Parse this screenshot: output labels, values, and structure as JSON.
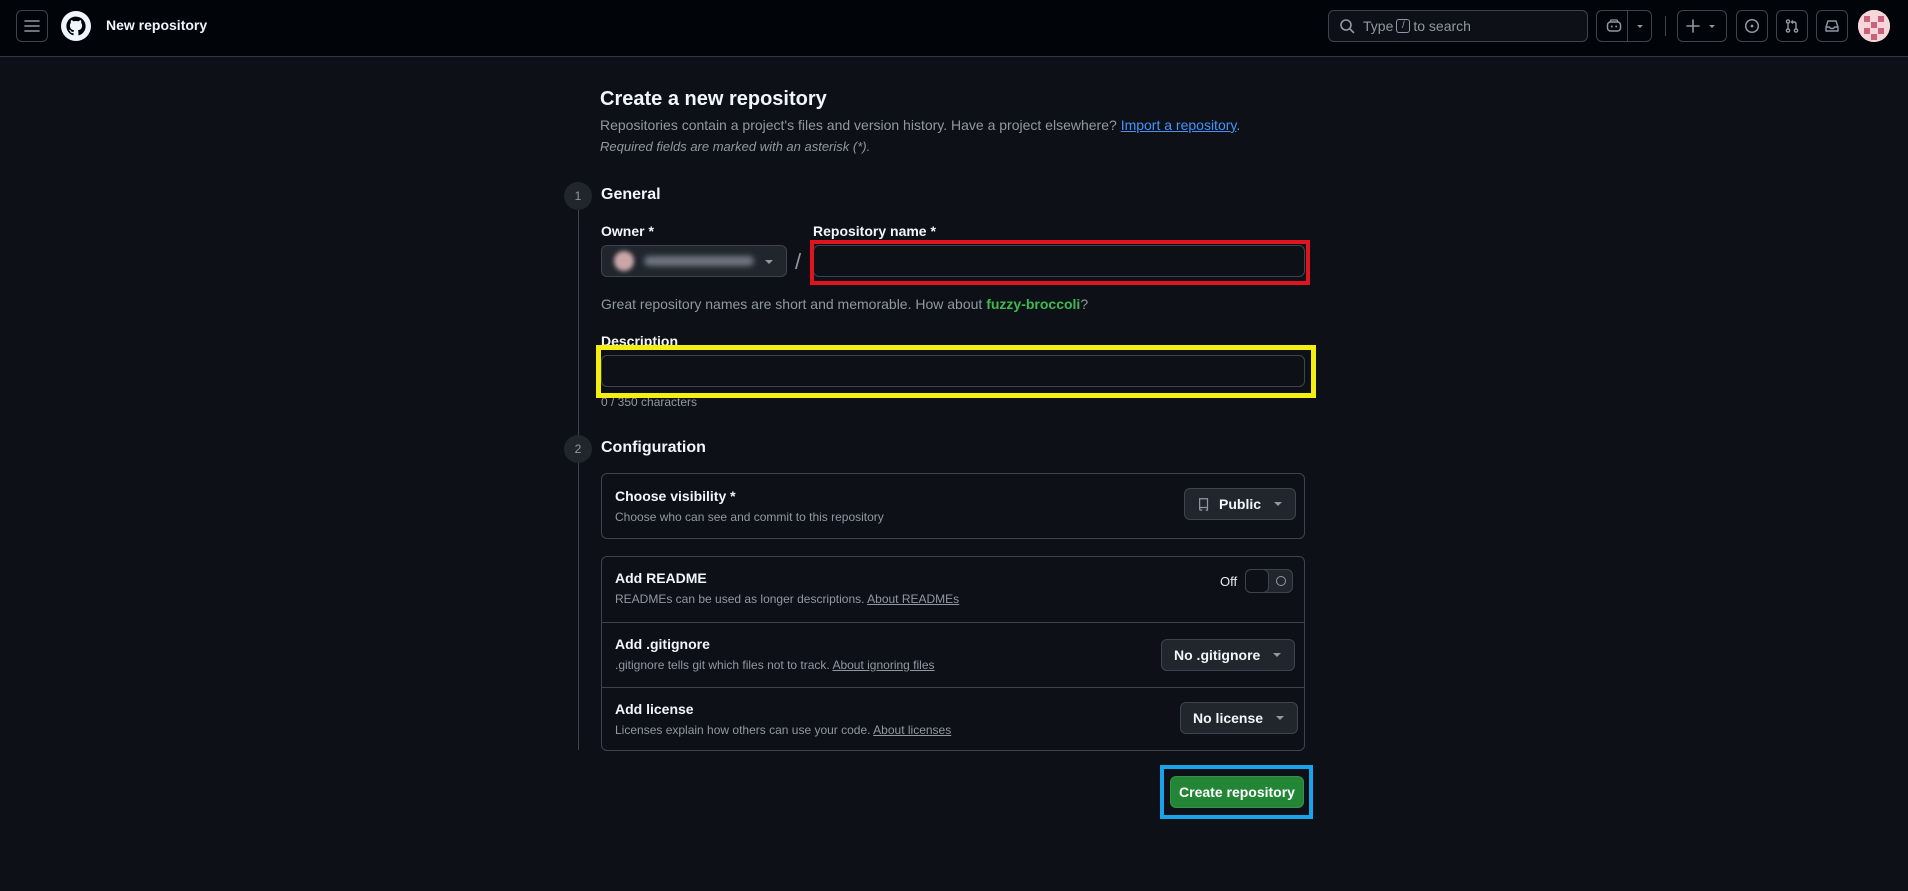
{
  "header": {
    "page_context": "New repository",
    "search": {
      "prefix": "Type",
      "key": "/",
      "suffix": "to search"
    }
  },
  "main": {
    "title": "Create a new repository",
    "subtitle": "Repositories contain a project's files and version history. Have a project elsewhere?",
    "import_link": "Import a repository",
    "subtitle_end": ".",
    "required_note": "Required fields are marked with an asterisk (*)."
  },
  "general": {
    "step": "1",
    "title": "General",
    "owner_label": "Owner *",
    "repo_name_label": "Repository name *",
    "repo_name_value": "",
    "slash": "/",
    "hint_prefix": "Great repository names are short and memorable. How about",
    "suggestion": "fuzzy-broccoli",
    "hint_suffix": "?",
    "description_label": "Description",
    "description_value": "",
    "char_count": "0 / 350 characters"
  },
  "configuration": {
    "step": "2",
    "title": "Configuration",
    "visibility": {
      "title": "Choose visibility *",
      "desc": "Choose who can see and commit to this repository",
      "value": "Public"
    },
    "readme": {
      "title": "Add README",
      "desc": "READMEs can be used as longer descriptions.",
      "link": "About READMEs",
      "toggle_label": "Off"
    },
    "gitignore": {
      "title": "Add .gitignore",
      "desc": ".gitignore tells git which files not to track.",
      "link": "About ignoring files",
      "value": "No .gitignore"
    },
    "license": {
      "title": "Add license",
      "desc": "Licenses explain how others can use your code.",
      "link": "About licenses",
      "value": "No license"
    }
  },
  "actions": {
    "create_label": "Create repository"
  },
  "colors": {
    "background": "#0d1117",
    "header_bg": "#010409",
    "primary_button": "#238636",
    "link": "#4493f8",
    "suggestion": "#3fb950",
    "highlight_red": "#e0141e",
    "highlight_yellow": "#f5ee12",
    "highlight_blue": "#1aa3e8"
  }
}
